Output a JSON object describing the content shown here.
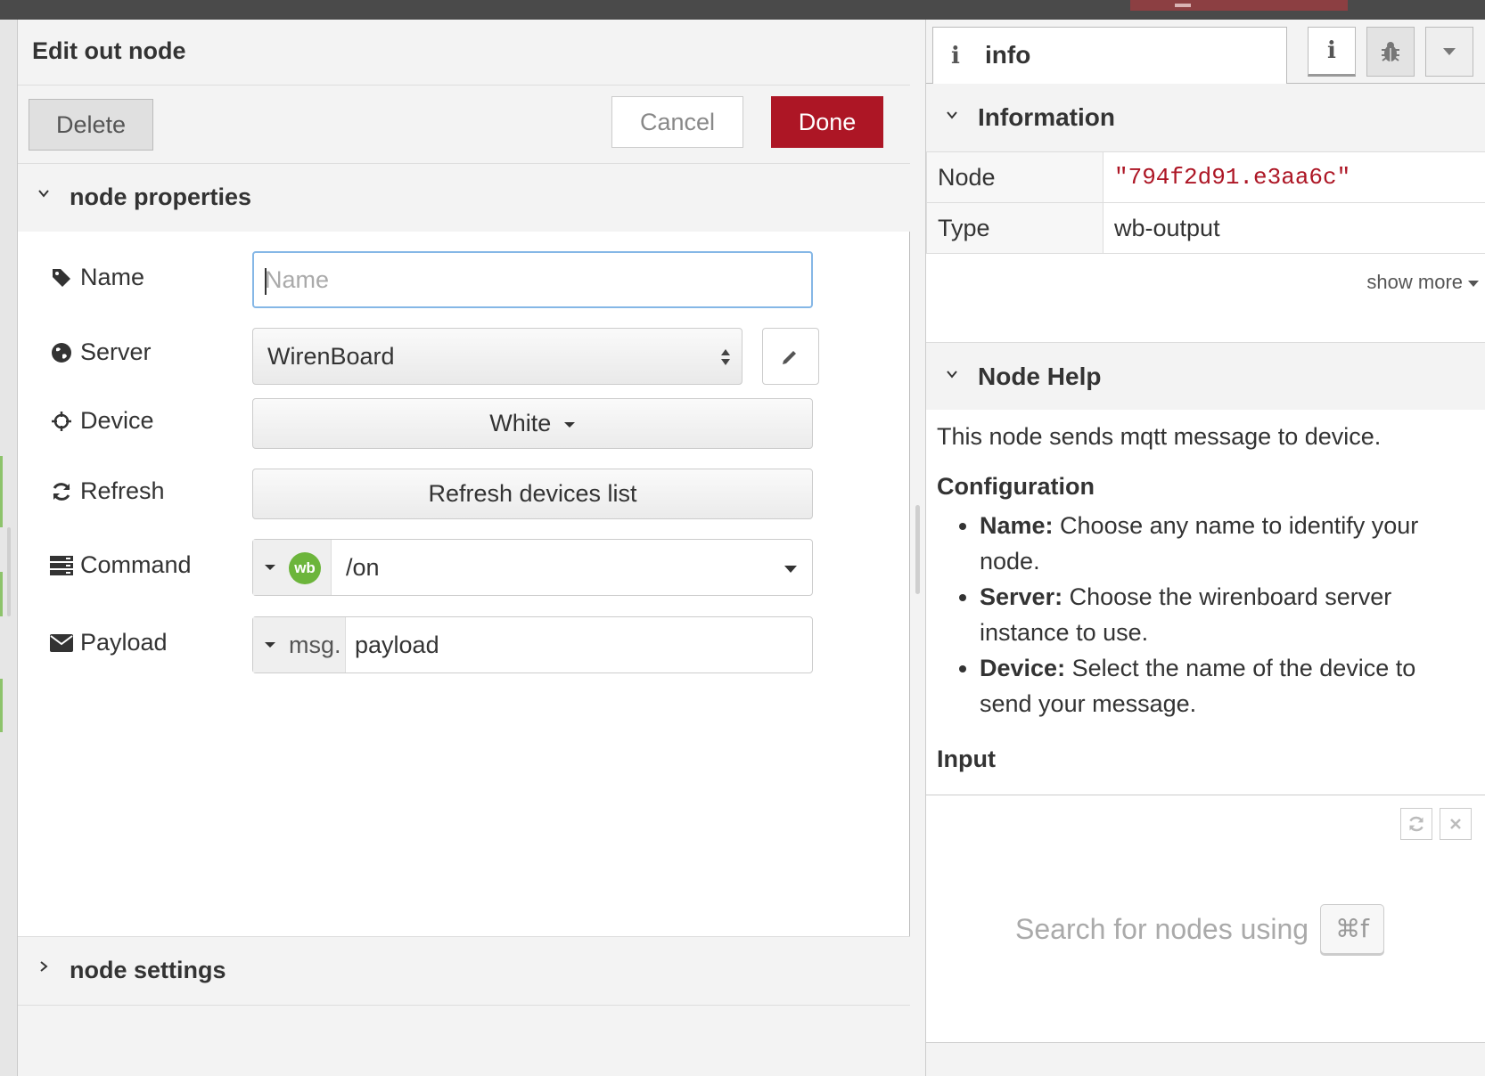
{
  "tray": {
    "title": "Edit out node",
    "delete_label": "Delete",
    "cancel_label": "Cancel",
    "done_label": "Done",
    "sections": {
      "properties": "node properties",
      "settings": "node settings"
    },
    "fields": {
      "name": {
        "label": "Name",
        "placeholder": "Name",
        "value": ""
      },
      "server": {
        "label": "Server",
        "value": "WirenBoard"
      },
      "device": {
        "label": "Device",
        "value": "White"
      },
      "refresh": {
        "label": "Refresh",
        "button": "Refresh devices list"
      },
      "command": {
        "label": "Command",
        "badge": "wb",
        "value": "/on"
      },
      "payload": {
        "label": "Payload",
        "prefix": "msg.",
        "value": "payload"
      }
    }
  },
  "sidebar": {
    "tab_label": "info",
    "tab_icon": "info-icon",
    "information_title": "Information",
    "rows": [
      {
        "key": "Node",
        "value": "\"794f2d91.e3aa6c\""
      },
      {
        "key": "Type",
        "value": "wb-output"
      }
    ],
    "show_more": "show more",
    "help_title": "Node Help",
    "help_intro": "This node sends mqtt message to device.",
    "config_title": "Configuration",
    "config_items": [
      {
        "term": "Name:",
        "text": "Choose any name to identify your node."
      },
      {
        "term": "Server:",
        "text": "Choose the wirenboard server instance to use."
      },
      {
        "term": "Device:",
        "text": "Select the name of the device to send your message."
      }
    ],
    "input_title": "Input",
    "search_hint": "Search for nodes using",
    "search_shortcut": "⌘f"
  },
  "colors": {
    "accent": "#ad1625",
    "wb_badge": "#6cb53b",
    "focus_border": "#85b7e6"
  }
}
